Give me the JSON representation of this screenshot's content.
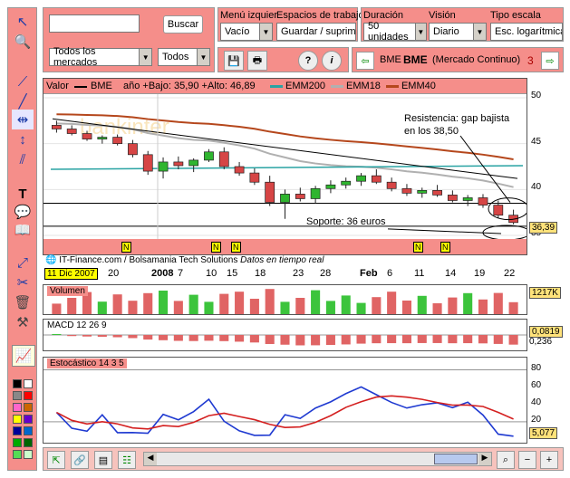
{
  "toolbar": {
    "search_placeholder": "",
    "search_value": "",
    "buscar_label": "Buscar",
    "market_select": "Todos los mercados",
    "type_select": "Todos",
    "menu_izq_label": "Menú izquier",
    "menu_izq_value": "Vacío",
    "workspace_label": "Espacios de trabajo",
    "workspace_value": "Guardar / suprimir",
    "duracion_label": "Duración",
    "duracion_value": "50 unidades",
    "vision_label": "Visión",
    "vision_value": "Diario",
    "escala_label": "Tipo escala",
    "escala_value": "Esc. logarítmica",
    "ticker_code": "BME",
    "ticker_name": "BME",
    "ticker_market": "(Mercado Continuo)",
    "ticker_extra": "3"
  },
  "chart_header": {
    "valor_label": "Valor",
    "valor_name": "BME",
    "range_text": "año +Bajo: 35,90 +Alto: 46,89",
    "legend": [
      {
        "name": "EMM200",
        "color": "#29a3a3"
      },
      {
        "name": "EMM18",
        "color": "#b0b0b0"
      },
      {
        "name": "EMM40",
        "color": "#b5471c"
      }
    ]
  },
  "annotations": {
    "resistance": "Resistencia: gap bajista",
    "resistance2": "en los 38,50",
    "support": "Soporte: 36 euros",
    "source": "IT-Finance.com / Bolsamania Tech Solutions",
    "source_italic": "Datos en tiempo real",
    "current_price": "36,39",
    "date_label": "11 Dic 2007",
    "watermark": "bankinter"
  },
  "x_ticks": [
    "20",
    "2008",
    "7",
    "10",
    "15",
    "18",
    "23",
    "28",
    "Feb",
    "6",
    "11",
    "14",
    "19",
    "22"
  ],
  "y_ticks": [
    "50",
    "45",
    "40",
    "35"
  ],
  "news_marker": "N",
  "volume": {
    "title": "Volumen",
    "value": "1217K"
  },
  "macd": {
    "title": "MACD 12 26 9",
    "value1": "0,0819",
    "value2": "0,236"
  },
  "stoch": {
    "title": "Estocástico 14 3 5",
    "ticks": [
      "80",
      "60",
      "40",
      "20"
    ],
    "value": "5,077"
  },
  "chart_data": {
    "type": "candlestick",
    "series": [
      {
        "name": "BME",
        "ohlc": [
          [
            47.0,
            47.5,
            46.2,
            46.6
          ],
          [
            46.6,
            47.0,
            45.9,
            46.1
          ],
          [
            46.1,
            46.4,
            45.3,
            45.5
          ],
          [
            45.5,
            45.9,
            45.0,
            45.7
          ],
          [
            45.7,
            46.0,
            44.8,
            45.0
          ],
          [
            45.0,
            45.4,
            43.5,
            43.8
          ],
          [
            43.8,
            44.2,
            41.6,
            42.0
          ],
          [
            42.0,
            43.5,
            41.2,
            43.0
          ],
          [
            43.0,
            43.6,
            42.2,
            42.6
          ],
          [
            42.6,
            43.4,
            41.9,
            43.2
          ],
          [
            43.2,
            44.4,
            43.0,
            44.1
          ],
          [
            44.1,
            44.6,
            42.2,
            42.5
          ],
          [
            42.5,
            43.0,
            41.5,
            41.8
          ],
          [
            41.8,
            42.3,
            40.5,
            40.8
          ],
          [
            40.8,
            41.5,
            38.2,
            38.6
          ],
          [
            38.6,
            40.0,
            36.8,
            39.5
          ],
          [
            39.5,
            40.2,
            38.7,
            39.0
          ],
          [
            39.0,
            40.4,
            38.5,
            40.1
          ],
          [
            40.1,
            41.0,
            39.6,
            40.5
          ],
          [
            40.5,
            41.3,
            40.1,
            40.9
          ],
          [
            40.9,
            41.8,
            40.4,
            41.5
          ],
          [
            41.5,
            42.2,
            40.6,
            40.8
          ],
          [
            40.8,
            41.3,
            39.8,
            40.1
          ],
          [
            40.1,
            40.6,
            39.3,
            39.6
          ],
          [
            39.6,
            40.2,
            39.1,
            39.9
          ],
          [
            39.9,
            40.5,
            39.2,
            39.4
          ],
          [
            39.4,
            39.9,
            38.6,
            38.8
          ],
          [
            38.8,
            39.4,
            38.2,
            39.1
          ],
          [
            39.1,
            39.5,
            38.0,
            38.3
          ],
          [
            38.3,
            38.8,
            36.9,
            37.2
          ],
          [
            37.2,
            37.8,
            36.2,
            36.4
          ]
        ]
      }
    ],
    "ylim": [
      35,
      50
    ],
    "y_ticks": [
      50,
      45,
      40,
      35
    ]
  }
}
